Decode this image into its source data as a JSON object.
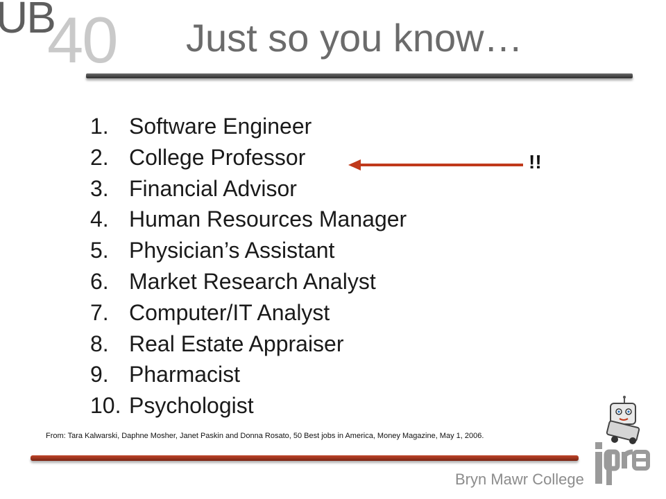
{
  "logo": {
    "prefix": "UB",
    "number": "40"
  },
  "title": "Just so you know…",
  "jobs": [
    {
      "num": "1.",
      "label": "Software Engineer"
    },
    {
      "num": "2.",
      "label": "College Professor"
    },
    {
      "num": "3.",
      "label": "Financial Advisor"
    },
    {
      "num": "4.",
      "label": "Human Resources Manager"
    },
    {
      "num": "5.",
      "label": "Physician’s Assistant"
    },
    {
      "num": "6.",
      "label": "Market Research Analyst"
    },
    {
      "num": "7.",
      "label": "Computer/IT Analyst"
    },
    {
      "num": "8.",
      "label": "Real Estate Appraiser"
    },
    {
      "num": "9.",
      "label": "Pharmacist"
    },
    {
      "num": "10.",
      "label": "Psychologist"
    }
  ],
  "annotation": {
    "mark": "!!",
    "arrow_color": "#c0391b"
  },
  "citation": "From: Tara Kalwarski, Daphne Mosher, Janet Paskin and Donna Rosato, 50 Best jobs in America, Money Magazine, May 1, 2006.",
  "footer": "Bryn Mawr College",
  "brand": {
    "logo_icon": "ipre-logo",
    "mascot_icon": "robot-icon"
  }
}
